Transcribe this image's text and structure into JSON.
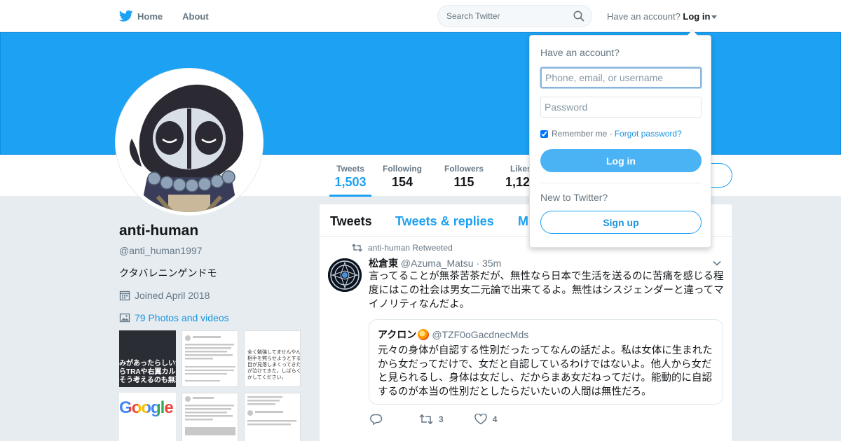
{
  "colors": {
    "brand": "#1da1f2",
    "banner": "#1da1f2",
    "link": "#1b95e0"
  },
  "nav": {
    "home_label": "Home",
    "about_label": "About",
    "search_placeholder": "Search Twitter",
    "account_question": "Have an account?",
    "login_label": "Log in"
  },
  "profile": {
    "name": "anti-human",
    "handle": "@anti_human1997",
    "bio": "クタバレニンゲンドモ",
    "joined": "Joined April 2018",
    "photos_link": "79 Photos and videos"
  },
  "stats": [
    {
      "label": "Tweets",
      "value": "1,503"
    },
    {
      "label": "Following",
      "value": "154"
    },
    {
      "label": "Followers",
      "value": "115"
    },
    {
      "label": "Likes",
      "value": "1,12"
    }
  ],
  "thumbnails": {
    "t1_text": "みがあったらしいが、\nらTRAや右翼カルト…\nそう考えるのも無理",
    "t3_text": "全く勉強してませんやん。\n相手を黙らせようとするか\n目が見落しまくってきたん\nが泣けてきた。しばらく勉\nかしてください。",
    "t4_text": "Google"
  },
  "timeline": {
    "tabs": [
      "Tweets",
      "Tweets & replies",
      "M"
    ],
    "tweet": {
      "retweet_context": "anti-human Retweeted",
      "author_name": "松倉東",
      "author_handle": "@Azuma_Matsu",
      "time": "· 35m",
      "text": "言ってることが無茶苦茶だが、無性なら日本で生活を送るのに苦痛を感じる程度にはこの社会は男女二元論で出来てるよ。無性はシスジェンダーと違ってマイノリティなんだよ。",
      "quote": {
        "author_name": "アクロン",
        "author_handle": "@TZF0oGacdnecMds",
        "text": "元々の身体が自認する性別だったってなんの話だよ。私は女体に生まれたから女だってだけで、女だと自認しているわけではないよ。他人から女だと見られるし、身体は女だし、だからまあ女だねってだけ。能動的に自認するのが本当の性別だとしたらだいたいの人間は無性だろ。"
      },
      "retweet_count": "3",
      "like_count": "4"
    }
  },
  "login_dropdown": {
    "title": "Have an account?",
    "username_placeholder": "Phone, email, or username",
    "password_placeholder": "Password",
    "remember_label": "Remember me",
    "forgot_label": "Forgot password?",
    "login_button": "Log in",
    "new_question": "New to Twitter?",
    "signup_button": "Sign up"
  }
}
